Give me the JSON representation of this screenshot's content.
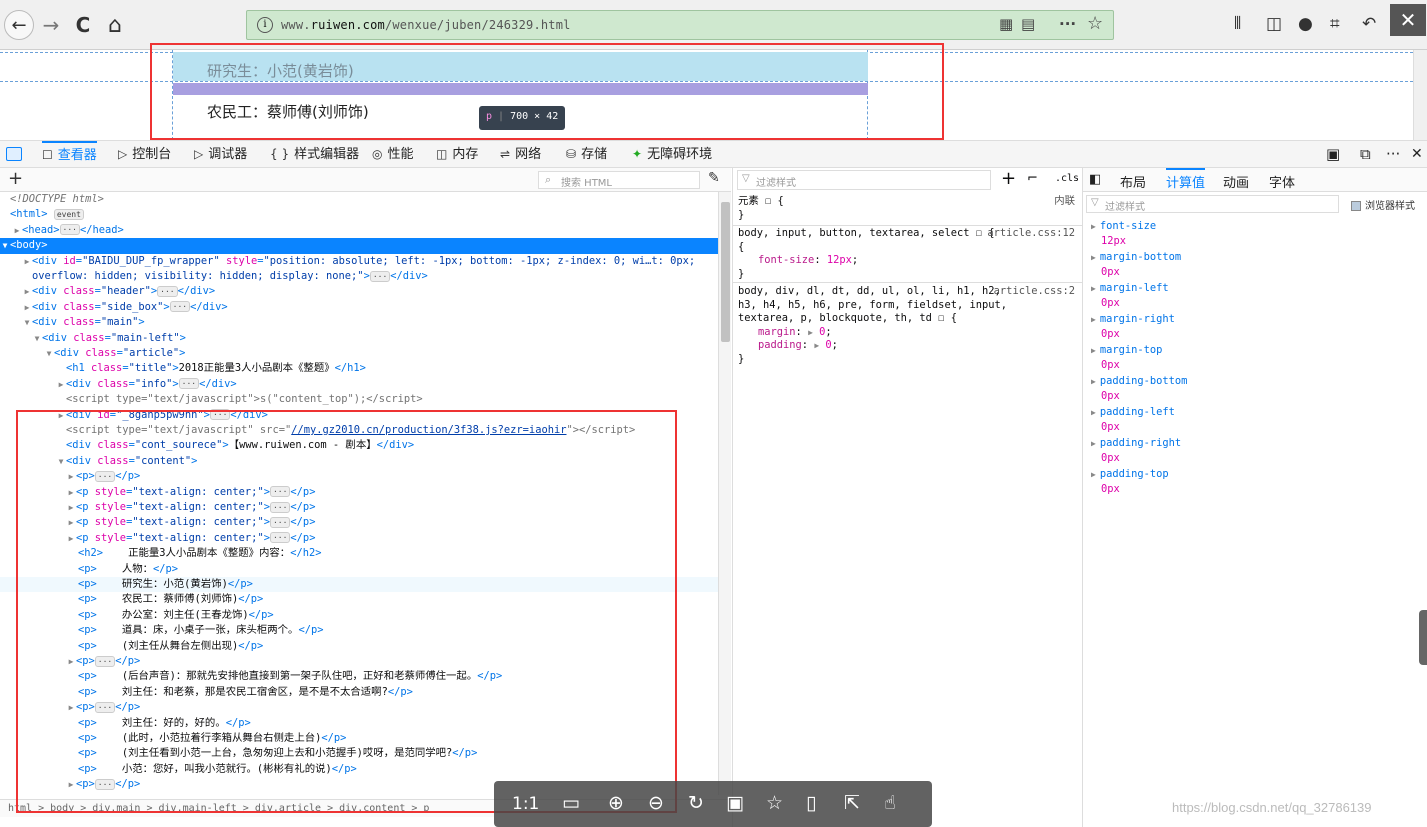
{
  "browser": {
    "url_prefix": "www.",
    "url_domain": "ruiwen.com",
    "url_path": "/wenxue/juben/246329.html",
    "close_glyph": "✕",
    "back_glyph": "←",
    "forward_glyph": "→",
    "reload_glyph": "C",
    "home_glyph": "⌂",
    "url_more_glyph": "···",
    "star_glyph": "☆"
  },
  "preview": {
    "line1": "研究生：小范(黄岩饰)",
    "line2": "农民工：蔡师傅(刘师饰)",
    "tip_tag": "p",
    "tip_width": "700",
    "tip_times": "×",
    "tip_height": "42"
  },
  "devtools": {
    "tabs": [
      {
        "icon": "☐",
        "label": "查看器"
      },
      {
        "icon": "▷",
        "label": "控制台"
      },
      {
        "icon": "▷",
        "label": "调试器"
      },
      {
        "icon": "{ }",
        "label": "样式编辑器"
      },
      {
        "icon": "◎",
        "label": "性能"
      },
      {
        "icon": "◫",
        "label": "内存"
      },
      {
        "icon": "⇌",
        "label": "网络"
      },
      {
        "icon": "⛁",
        "label": "存储"
      },
      {
        "icon": "✦",
        "label": "无障碍环境"
      }
    ],
    "markup_search_placeholder": "搜索 HTML",
    "add_glyph": "+",
    "breadcrumbs": "html > body > div.main > div.main-left > div.article > div.content > p"
  },
  "markup": {
    "doctype": "<!DOCTYPE html>",
    "event_badge": "event",
    "fp_id": "BAIDU_DUP_fp_wrapper",
    "fp_style1": "position: absolute; left: -1px; bottom: -1px; z-index: 0; wi…t: 0px;",
    "fp_style2": "overflow: hidden; visibility: hidden; display: none;",
    "title_text": "2018正能量3人小品剧本《整题》",
    "script1": "s(\"content_top\");",
    "hidden_id": "_8ganp5pw9hh",
    "script2_src": "//my.gz2010.cn/production/3f38.js?ezr=iaohir",
    "cont_source": "【www.ruiwen.com - 剧本】",
    "h2_text": "正能量3人小品剧本《整题》内容：",
    "lines": [
      "人物：",
      "研究生：小范(黄岩饰)",
      "农民工：蔡师傅(刘师饰)",
      "办公室：刘主任(王春龙饰)",
      "道具：床，小桌子一张，床头柜两个。",
      "(刘主任从舞台左侧出现)"
    ],
    "lines2": [
      "(后台声音)：那就先安排他直接到第一架子队住吧，正好和老蔡师傅住一起。",
      "刘主任：和老蔡，那是农民工宿舍区，是不是不太合适啊?"
    ],
    "lines3": [
      "刘主任：好的，好的。",
      "(此时，小范拉着行李箱从舞台右侧走上台)",
      "(刘主任看到小范一上台，急匆匆迎上去和小范握手)哎呀，是范同学吧?",
      "小范：您好，叫我小范就行。(彬彬有礼的说)"
    ]
  },
  "rules": {
    "filter_placeholder": "过滤样式",
    "cls_label": ".cls",
    "element_selector": "元素 ☐ {",
    "inline_label": "内联",
    "close_brace": "}",
    "rule1_selector": "body, input, button, textarea, select ☐ {",
    "rule1_source": "article.css:12",
    "rule1_prop": "font-size",
    "rule1_val": "12px",
    "rule2_sel1": "body, div, dl, dt, dd, ul, ol, li, h1, h2,",
    "rule2_sel2": "h3, h4, h5, h6, pre, form, fieldset, input,",
    "rule2_sel3": "textarea, p, blockquote, th, td ☐ {",
    "rule2_source": "article.css:2",
    "rule2_prop1": "margin",
    "rule2_prop2": "padding",
    "rule2_val": "0"
  },
  "computed": {
    "tabs": [
      "布局",
      "计算值",
      "动画",
      "字体"
    ],
    "filter_placeholder": "过滤样式",
    "browser_styles_label": "浏览器样式",
    "props": [
      {
        "name": "font-size",
        "value": "12px"
      },
      {
        "name": "margin-bottom",
        "value": "0px"
      },
      {
        "name": "margin-left",
        "value": "0px"
      },
      {
        "name": "margin-right",
        "value": "0px"
      },
      {
        "name": "margin-top",
        "value": "0px"
      },
      {
        "name": "padding-bottom",
        "value": "0px"
      },
      {
        "name": "padding-left",
        "value": "0px"
      },
      {
        "name": "padding-right",
        "value": "0px"
      },
      {
        "name": "padding-top",
        "value": "0px"
      }
    ]
  },
  "viewer": {
    "ratio_label": "1:1",
    "watermark": "https://blog.csdn.net/qq_32786139"
  },
  "colors": {
    "accent": "#0a84ff",
    "highlight_box": "#e33333",
    "url_bar": "#cfe8cf"
  }
}
